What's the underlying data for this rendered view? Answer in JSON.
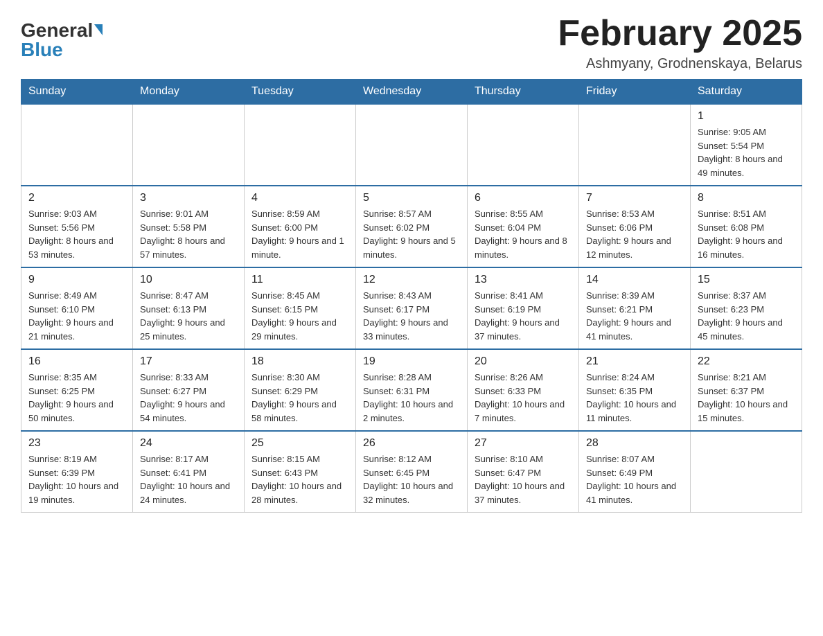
{
  "header": {
    "logo_general": "General",
    "logo_blue": "Blue",
    "title": "February 2025",
    "subtitle": "Ashmyany, Grodnenskaya, Belarus"
  },
  "weekdays": [
    "Sunday",
    "Monday",
    "Tuesday",
    "Wednesday",
    "Thursday",
    "Friday",
    "Saturday"
  ],
  "weeks": [
    [
      {
        "day": "",
        "info": ""
      },
      {
        "day": "",
        "info": ""
      },
      {
        "day": "",
        "info": ""
      },
      {
        "day": "",
        "info": ""
      },
      {
        "day": "",
        "info": ""
      },
      {
        "day": "",
        "info": ""
      },
      {
        "day": "1",
        "info": "Sunrise: 9:05 AM\nSunset: 5:54 PM\nDaylight: 8 hours and 49 minutes."
      }
    ],
    [
      {
        "day": "2",
        "info": "Sunrise: 9:03 AM\nSunset: 5:56 PM\nDaylight: 8 hours and 53 minutes."
      },
      {
        "day": "3",
        "info": "Sunrise: 9:01 AM\nSunset: 5:58 PM\nDaylight: 8 hours and 57 minutes."
      },
      {
        "day": "4",
        "info": "Sunrise: 8:59 AM\nSunset: 6:00 PM\nDaylight: 9 hours and 1 minute."
      },
      {
        "day": "5",
        "info": "Sunrise: 8:57 AM\nSunset: 6:02 PM\nDaylight: 9 hours and 5 minutes."
      },
      {
        "day": "6",
        "info": "Sunrise: 8:55 AM\nSunset: 6:04 PM\nDaylight: 9 hours and 8 minutes."
      },
      {
        "day": "7",
        "info": "Sunrise: 8:53 AM\nSunset: 6:06 PM\nDaylight: 9 hours and 12 minutes."
      },
      {
        "day": "8",
        "info": "Sunrise: 8:51 AM\nSunset: 6:08 PM\nDaylight: 9 hours and 16 minutes."
      }
    ],
    [
      {
        "day": "9",
        "info": "Sunrise: 8:49 AM\nSunset: 6:10 PM\nDaylight: 9 hours and 21 minutes."
      },
      {
        "day": "10",
        "info": "Sunrise: 8:47 AM\nSunset: 6:13 PM\nDaylight: 9 hours and 25 minutes."
      },
      {
        "day": "11",
        "info": "Sunrise: 8:45 AM\nSunset: 6:15 PM\nDaylight: 9 hours and 29 minutes."
      },
      {
        "day": "12",
        "info": "Sunrise: 8:43 AM\nSunset: 6:17 PM\nDaylight: 9 hours and 33 minutes."
      },
      {
        "day": "13",
        "info": "Sunrise: 8:41 AM\nSunset: 6:19 PM\nDaylight: 9 hours and 37 minutes."
      },
      {
        "day": "14",
        "info": "Sunrise: 8:39 AM\nSunset: 6:21 PM\nDaylight: 9 hours and 41 minutes."
      },
      {
        "day": "15",
        "info": "Sunrise: 8:37 AM\nSunset: 6:23 PM\nDaylight: 9 hours and 45 minutes."
      }
    ],
    [
      {
        "day": "16",
        "info": "Sunrise: 8:35 AM\nSunset: 6:25 PM\nDaylight: 9 hours and 50 minutes."
      },
      {
        "day": "17",
        "info": "Sunrise: 8:33 AM\nSunset: 6:27 PM\nDaylight: 9 hours and 54 minutes."
      },
      {
        "day": "18",
        "info": "Sunrise: 8:30 AM\nSunset: 6:29 PM\nDaylight: 9 hours and 58 minutes."
      },
      {
        "day": "19",
        "info": "Sunrise: 8:28 AM\nSunset: 6:31 PM\nDaylight: 10 hours and 2 minutes."
      },
      {
        "day": "20",
        "info": "Sunrise: 8:26 AM\nSunset: 6:33 PM\nDaylight: 10 hours and 7 minutes."
      },
      {
        "day": "21",
        "info": "Sunrise: 8:24 AM\nSunset: 6:35 PM\nDaylight: 10 hours and 11 minutes."
      },
      {
        "day": "22",
        "info": "Sunrise: 8:21 AM\nSunset: 6:37 PM\nDaylight: 10 hours and 15 minutes."
      }
    ],
    [
      {
        "day": "23",
        "info": "Sunrise: 8:19 AM\nSunset: 6:39 PM\nDaylight: 10 hours and 19 minutes."
      },
      {
        "day": "24",
        "info": "Sunrise: 8:17 AM\nSunset: 6:41 PM\nDaylight: 10 hours and 24 minutes."
      },
      {
        "day": "25",
        "info": "Sunrise: 8:15 AM\nSunset: 6:43 PM\nDaylight: 10 hours and 28 minutes."
      },
      {
        "day": "26",
        "info": "Sunrise: 8:12 AM\nSunset: 6:45 PM\nDaylight: 10 hours and 32 minutes."
      },
      {
        "day": "27",
        "info": "Sunrise: 8:10 AM\nSunset: 6:47 PM\nDaylight: 10 hours and 37 minutes."
      },
      {
        "day": "28",
        "info": "Sunrise: 8:07 AM\nSunset: 6:49 PM\nDaylight: 10 hours and 41 minutes."
      },
      {
        "day": "",
        "info": ""
      }
    ]
  ]
}
